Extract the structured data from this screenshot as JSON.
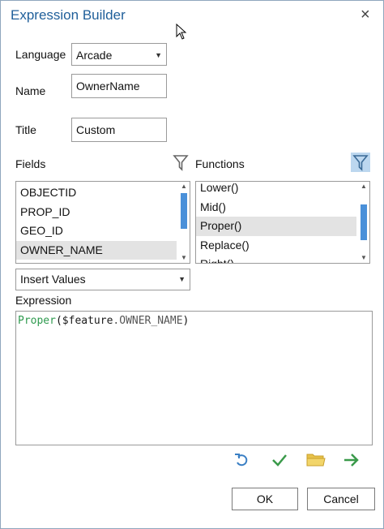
{
  "dialog": {
    "title": "Expression Builder",
    "close_label": "×"
  },
  "language": {
    "label": "Language",
    "value": "Arcade"
  },
  "name": {
    "label": "Name",
    "value": "OwnerName"
  },
  "title_field": {
    "label": "Title",
    "value": "Custom"
  },
  "fields": {
    "label": "Fields",
    "items": [
      "OBJECTID",
      "PROP_ID",
      "GEO_ID",
      "OWNER_NAME"
    ],
    "selected_index": 3
  },
  "functions": {
    "label": "Functions",
    "items": [
      "Lower()",
      "Mid()",
      "Proper()",
      "Replace()",
      "Right()"
    ],
    "selected_index": 2
  },
  "insert": {
    "value": "Insert Values"
  },
  "expression": {
    "label": "Expression",
    "func": "Proper",
    "open": "(",
    "global": "$feature",
    "field": ".OWNER_NAME",
    "close": ")"
  },
  "icons": {
    "undo": "undo-icon",
    "verify": "checkmark-icon",
    "open": "folder-icon",
    "apply": "arrow-right-icon",
    "filter": "filter-icon"
  },
  "colors": {
    "accent": "#4a90d9",
    "title": "#1f5f9a",
    "keyword": "#2e9a4e"
  },
  "buttons": {
    "ok": "OK",
    "cancel": "Cancel"
  }
}
